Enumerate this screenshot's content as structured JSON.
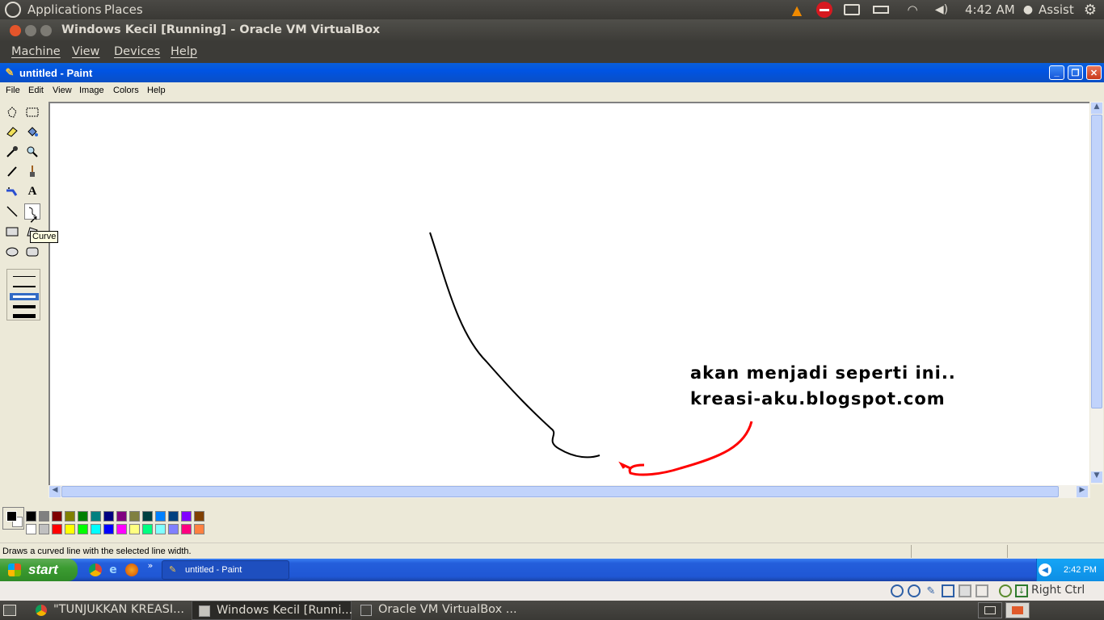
{
  "ubuntu_panel": {
    "applications": "Applications",
    "places": "Places",
    "clock": "4:42 AM",
    "user": "Assist"
  },
  "vbox": {
    "title": "Windows Kecil [Running] - Oracle VM VirtualBox",
    "menu": [
      "Machine",
      "View",
      "Devices",
      "Help"
    ],
    "host_key": "Right Ctrl"
  },
  "paint": {
    "title": "untitled - Paint",
    "menu": [
      "File",
      "Edit",
      "View",
      "Image",
      "Colors",
      "Help"
    ],
    "tooltip": "Curve",
    "status": "Draws a curved line with the selected line width.",
    "annotation_line1": "akan menjadi seperti ini..",
    "annotation_line2": "kreasi-aku.blogspot.com",
    "palette_top": [
      "#000000",
      "#808080",
      "#800000",
      "#808000",
      "#008000",
      "#008080",
      "#000080",
      "#800080",
      "#808040",
      "#004040",
      "#0080ff",
      "#004080",
      "#8000ff",
      "#804000"
    ],
    "palette_bottom": [
      "#ffffff",
      "#c0c0c0",
      "#ff0000",
      "#ffff00",
      "#00ff00",
      "#00ffff",
      "#0000ff",
      "#ff00ff",
      "#ffff80",
      "#00ff80",
      "#80ffff",
      "#8080ff",
      "#ff0080",
      "#ff8040"
    ]
  },
  "xp_taskbar": {
    "start": "start",
    "task": "untitled - Paint",
    "clock": "2:42 PM"
  },
  "ubuntu_bottom": {
    "tasks": [
      "\"TUNJUKKAN KREASI...",
      "Windows Kecil [Runni...",
      "Oracle VM VirtualBox ..."
    ]
  }
}
